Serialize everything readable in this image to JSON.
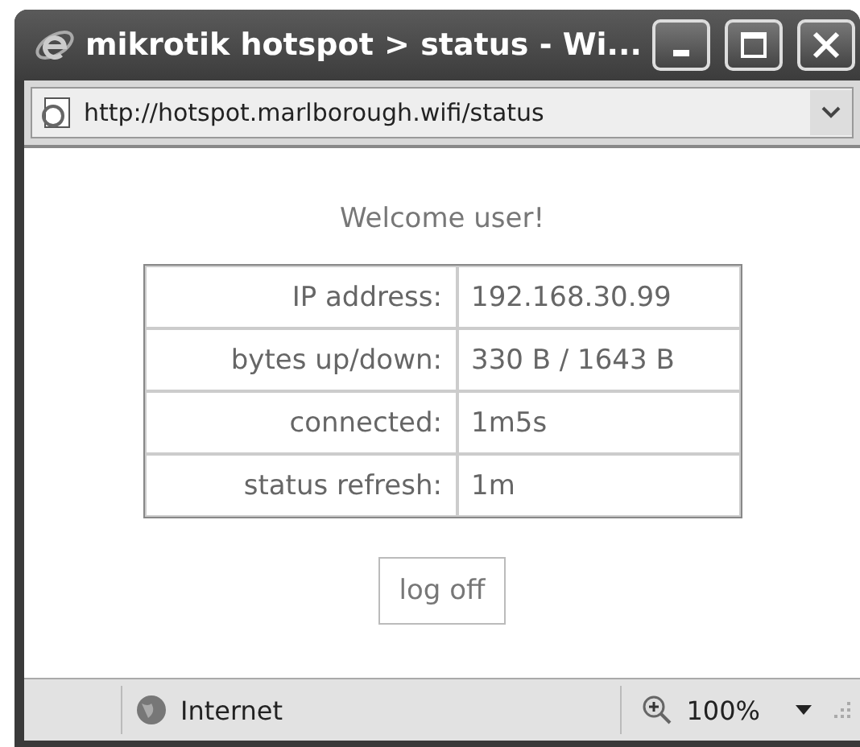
{
  "window": {
    "title": "mikrotik hotspot > status - Wi..."
  },
  "address_bar": {
    "url": "http://hotspot.marlborough.wifi/status"
  },
  "page": {
    "heading": "Welcome user!",
    "rows": [
      {
        "label": "IP address:",
        "value": "192.168.30.99"
      },
      {
        "label": "bytes up/down:",
        "value": "330 B / 1643 B"
      },
      {
        "label": "connected:",
        "value": "1m5s"
      },
      {
        "label": "status refresh:",
        "value": "1m"
      }
    ],
    "button": "log off"
  },
  "status_bar": {
    "zone": "Internet",
    "zoom": "100%"
  }
}
